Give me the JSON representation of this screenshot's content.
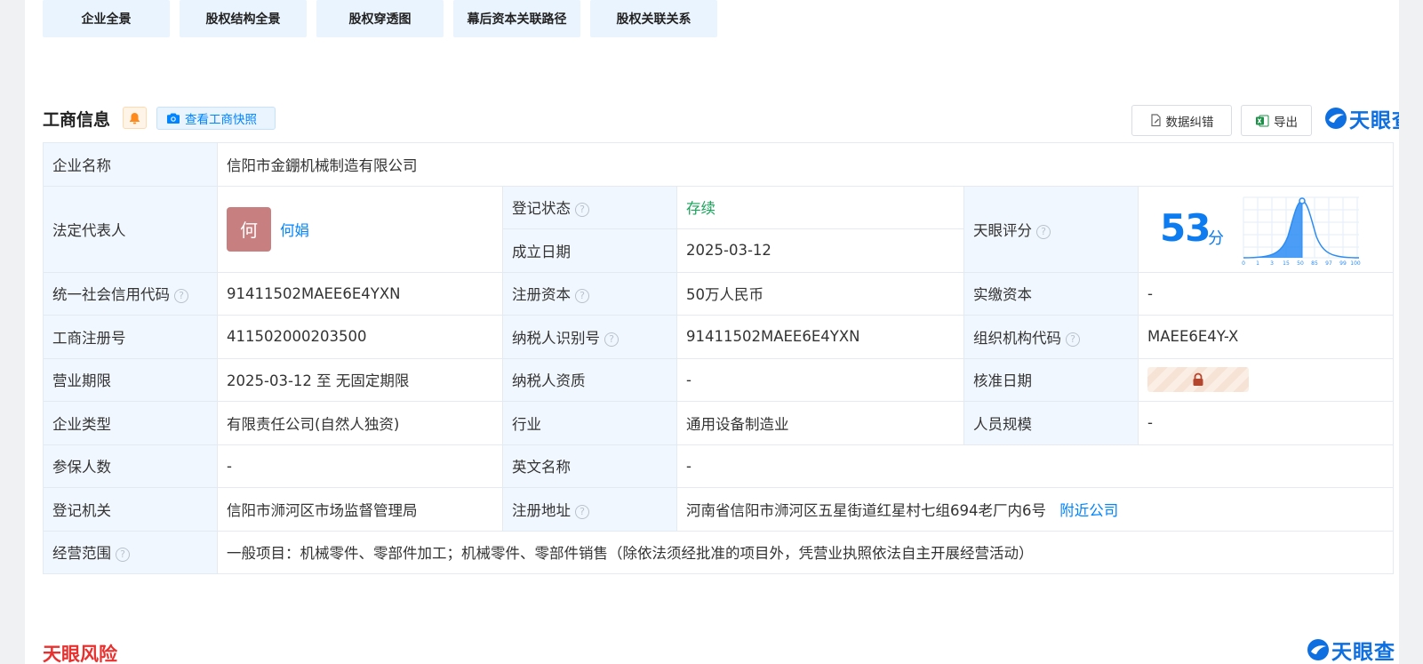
{
  "tabs": [
    "企业全景",
    "股权结构全景",
    "股权穿透图",
    "幕后资本关联路径",
    "股权关联关系"
  ],
  "section": {
    "title": "工商信息",
    "snapshot_label": "查看工商快照",
    "error_btn": "数据纠错",
    "export_btn": "导出",
    "logo_text": "天眼查"
  },
  "labels": {
    "company_name": "企业名称",
    "legal_rep": "法定代表人",
    "reg_status": "登记状态",
    "founded": "成立日期",
    "score": "天眼评分",
    "credit_code": "统一社会信用代码",
    "reg_capital": "注册资本",
    "paid_capital": "实缴资本",
    "reg_no": "工商注册号",
    "taxpayer_id": "纳税人识别号",
    "org_code": "组织机构代码",
    "term": "营业期限",
    "taxpayer_qual": "纳税人资质",
    "approve_date": "核准日期",
    "company_type": "企业类型",
    "industry": "行业",
    "staff_size": "人员规模",
    "insured": "参保人数",
    "english_name": "英文名称",
    "reg_authority": "登记机关",
    "reg_address": "注册地址",
    "scope": "经营范围"
  },
  "values": {
    "company_name": "信阳市金錋机械制造有限公司",
    "legal_rep_avatar": "何",
    "legal_rep": "何娟",
    "reg_status": "存续",
    "founded": "2025-03-12",
    "score": "53",
    "score_unit": "分",
    "credit_code": "91411502MAEE6E4YXN",
    "reg_capital": "50万人民币",
    "paid_capital": "-",
    "reg_no": "411502000203500",
    "taxpayer_id": "91411502MAEE6E4YXN",
    "org_code": "MAEE6E4Y-X",
    "term": "2025-03-12 至 无固定期限",
    "taxpayer_qual": "-",
    "company_type": "有限责任公司(自然人独资)",
    "industry": "通用设备制造业",
    "staff_size": "-",
    "insured": "-",
    "english_name": "-",
    "reg_authority": "信阳市浉河区市场监督管理局",
    "reg_address": "河南省信阳市浉河区五星街道红星村七组694老厂内6号",
    "nearby_link": "附近公司",
    "scope": "一般项目：机械零件、零部件加工；机械零件、零部件销售（除依法须经批准的项目外，凭营业执照依法自主开展经营活动）"
  },
  "score_axis": [
    "0",
    "1",
    "3",
    "15",
    "50",
    "85",
    "97",
    "99",
    "100"
  ],
  "risk_title": "天眼风险",
  "colors": {
    "accent": "#0084ff",
    "status_green": "#1aa35a",
    "risk_red": "#e8312f",
    "label_bg": "#f1f7fe"
  }
}
